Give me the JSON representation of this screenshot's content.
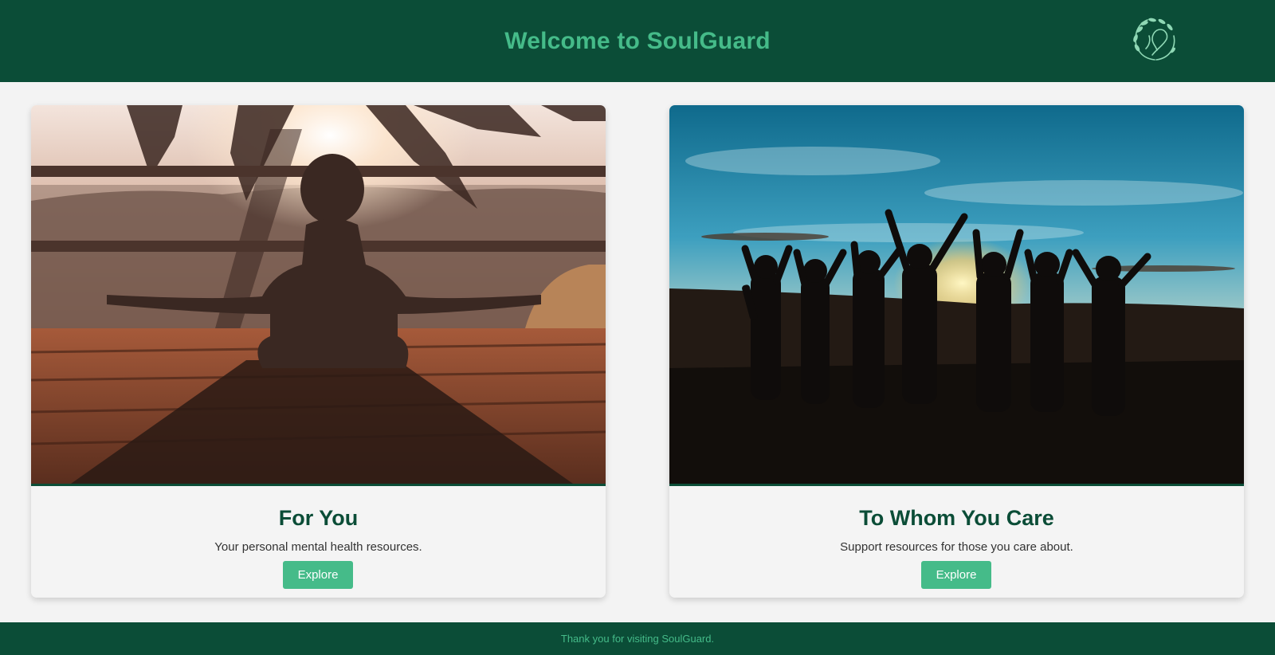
{
  "header": {
    "title": "Welcome to SoulGuard",
    "logo_icon": "leaf-wreath-logo-icon"
  },
  "cards": [
    {
      "image": "meditation-silhouette-sunset-photo",
      "title": "For You",
      "description": "Your personal mental health resources.",
      "button_label": "Explore"
    },
    {
      "image": "group-raised-arms-sunset-photo",
      "title": "To Whom You Care",
      "description": "Support resources for those you care about.",
      "button_label": "Explore"
    }
  ],
  "footer": {
    "text": "Thank you for visiting SoulGuard."
  },
  "colors": {
    "brand_dark": "#0b4d37",
    "accent": "#45bb89",
    "background": "#f3f3f3"
  }
}
